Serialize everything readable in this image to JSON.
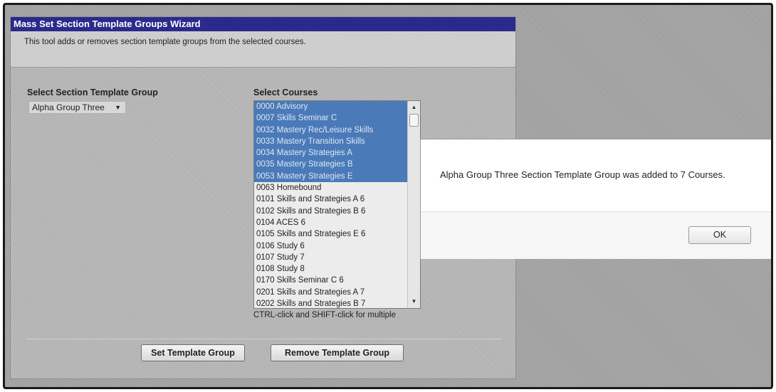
{
  "wizard": {
    "title": "Mass Set Section Template Groups Wizard",
    "description": "This tool adds or removes section template groups from the selected courses.",
    "group_label": "Select Section Template Group",
    "group_value": "Alpha Group Three",
    "courses_label": "Select Courses",
    "courses": [
      {
        "label": "0000 Advisory",
        "selected": true
      },
      {
        "label": "0007 Skills Seminar C",
        "selected": true
      },
      {
        "label": "0032 Mastery Rec/Leisure Skills",
        "selected": true
      },
      {
        "label": "0033 Mastery Transition Skills",
        "selected": true
      },
      {
        "label": "0034 Mastery Strategies A",
        "selected": true
      },
      {
        "label": "0035 Mastery Strategies B",
        "selected": true
      },
      {
        "label": "0053 Mastery Strategies E",
        "selected": true
      },
      {
        "label": "0063 Homebound",
        "selected": false
      },
      {
        "label": "0101 Skills and Strategies A 6",
        "selected": false
      },
      {
        "label": "0102 Skills and Strategies B 6",
        "selected": false
      },
      {
        "label": "0104 ACES 6",
        "selected": false
      },
      {
        "label": "0105 Skills and Strategies E 6",
        "selected": false
      },
      {
        "label": "0106 Study 6",
        "selected": false
      },
      {
        "label": "0107 Study 7",
        "selected": false
      },
      {
        "label": "0108 Study 8",
        "selected": false
      },
      {
        "label": "0170 Skills Seminar C 6",
        "selected": false
      },
      {
        "label": "0201 Skills and Strategies A 7",
        "selected": false
      },
      {
        "label": "0202 Skills and Strategies B 7",
        "selected": false
      }
    ],
    "hint": "CTRL-click and SHIFT-click for multiple",
    "set_button": "Set Template Group",
    "remove_button": "Remove Template Group"
  },
  "dialog": {
    "message": "Alpha Group Three Section Template Group was added to 7 Courses.",
    "ok_button": "OK"
  },
  "colors": {
    "title_bar": "#2a2a8c",
    "selection": "#4a7ab8"
  }
}
